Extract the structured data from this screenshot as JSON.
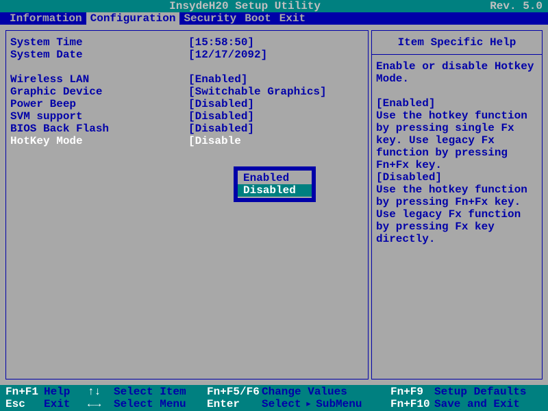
{
  "title": "InsydeH20 Setup Utility",
  "revision": "Rev. 5.0",
  "tabs": [
    "Information",
    "Configuration",
    "Security",
    "Boot",
    "Exit"
  ],
  "active_tab": 1,
  "settings": {
    "time_label": "System Time",
    "time_value": "[15:58:50]",
    "date_label": "System Date",
    "date_value": "[12/17/2092]",
    "wlan_label": "Wireless LAN",
    "wlan_value": "[Enabled]",
    "gfx_label": "Graphic Device",
    "gfx_value": "[Switchable Graphics]",
    "beep_label": "Power Beep",
    "beep_value": "[Disabled]",
    "svm_label": "SVM support",
    "svm_value": "[Disabled]",
    "bbf_label": "BIOS Back Flash",
    "bbf_value": "[Disabled]",
    "hotkey_label": "HotKey Mode",
    "hotkey_value": "[Disable"
  },
  "popup": {
    "opt0": "Enabled",
    "opt1": "Disabled"
  },
  "help": {
    "title": "Item Specific Help",
    "body": "Enable or disable Hotkey Mode.\n\n[Enabled]\nUse the hotkey function by pressing single Fx key. Use legacy Fx function by pressing Fn+Fx key.\n[Disabled]\nUse the hotkey function by pressing Fn+Fx key. Use legacy Fx function by pressing Fx key directly."
  },
  "footer": {
    "f1_key": "Fn+F1",
    "f1_desc": "Help",
    "ud_key": "↑↓",
    "ud_desc": "Select Item",
    "f56_key": "Fn+F5/F6",
    "f56_desc": "Change Values",
    "f9_key": "Fn+F9",
    "f9_desc": "Setup Defaults",
    "esc_key": "Esc",
    "esc_desc": "Exit",
    "lr_key": "←→",
    "lr_desc": "Select Menu",
    "ent_key": "Enter",
    "ent_desc": "Select",
    "sub_desc": "SubMenu",
    "f10_key": "Fn+F10",
    "f10_desc": "Save and Exit",
    "triangle": "▸"
  }
}
